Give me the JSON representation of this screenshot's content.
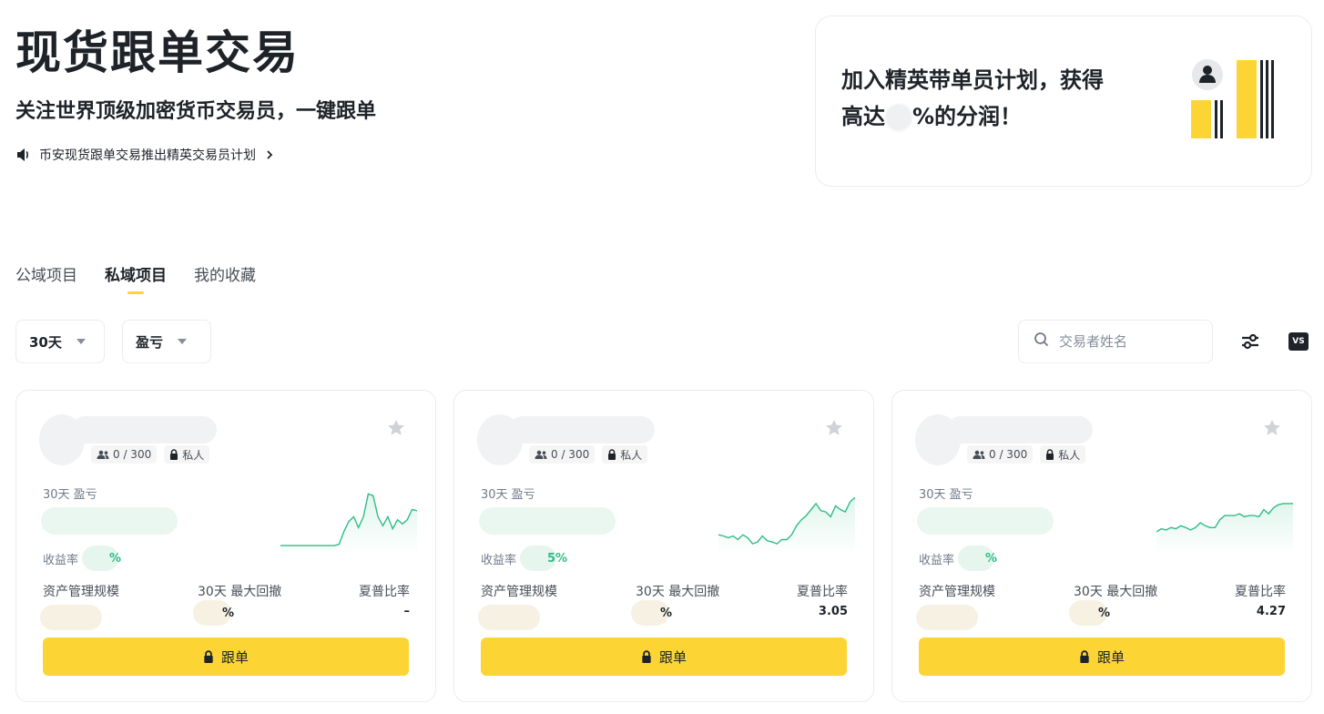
{
  "hero": {
    "title": "现货跟单交易",
    "subtitle": "关注世界顶级加密货币交易员，一键跟单",
    "announcement": "币安现货跟单交易推出精英交易员计划"
  },
  "promo": {
    "line1": "加入精英带单员计划，获得",
    "line2_prefix": "高达",
    "line2_suffix": "%的分润！"
  },
  "tabs": [
    {
      "label": "公域项目",
      "active": false
    },
    {
      "label": "私域项目",
      "active": true
    },
    {
      "label": "我的收藏",
      "active": false
    }
  ],
  "filters": {
    "period": "30天",
    "sort": "盈亏",
    "search_placeholder": "交易者姓名",
    "vs_label": "VS"
  },
  "cards": [
    {
      "followers": "0 / 300",
      "privacy": "私人",
      "pnl_label": "30天 盈亏",
      "roi_label": "收益率",
      "roi_suffix": "%",
      "aum_label": "资产管理规模",
      "mdd_label": "30天 最大回撤",
      "mdd_suffix": "%",
      "sharpe_label": "夏普比率",
      "sharpe_value": "–",
      "follow_label": "跟单",
      "sparkline": [
        0.12,
        0.12,
        0.12,
        0.12,
        0.12,
        0.12,
        0.12,
        0.12,
        0.12,
        0.12,
        0.12,
        0.12,
        0.14,
        0.35,
        0.52,
        0.6,
        0.42,
        0.6,
        0.98,
        0.95,
        0.6,
        0.45,
        0.6,
        0.4,
        0.55,
        0.48,
        0.55,
        0.72,
        0.7
      ]
    },
    {
      "followers": "0 / 300",
      "privacy": "私人",
      "pnl_label": "30天 盈亏",
      "roi_label": "收益率",
      "roi_suffix": "5%",
      "aum_label": "资产管理规模",
      "mdd_label": "30天 最大回撤",
      "mdd_suffix": "%",
      "sharpe_label": "夏普比率",
      "sharpe_value": "3.05",
      "follow_label": "跟单",
      "sparkline": [
        0.3,
        0.28,
        0.25,
        0.28,
        0.22,
        0.3,
        0.25,
        0.15,
        0.18,
        0.28,
        0.2,
        0.18,
        0.15,
        0.22,
        0.22,
        0.3,
        0.45,
        0.55,
        0.62,
        0.72,
        0.82,
        0.7,
        0.68,
        0.6,
        0.78,
        0.72,
        0.68,
        0.85,
        0.92
      ]
    },
    {
      "followers": "0 / 300",
      "privacy": "私人",
      "pnl_label": "30天 盈亏",
      "roi_label": "收益率",
      "roi_suffix": "%",
      "aum_label": "资产管理规模",
      "mdd_label": "30天 最大回撤",
      "mdd_suffix": "%",
      "sharpe_label": "夏普比率",
      "sharpe_value": "4.27",
      "follow_label": "跟单",
      "sparkline": [
        0.35,
        0.4,
        0.38,
        0.42,
        0.4,
        0.45,
        0.42,
        0.38,
        0.42,
        0.5,
        0.45,
        0.42,
        0.42,
        0.55,
        0.62,
        0.62,
        0.62,
        0.65,
        0.6,
        0.62,
        0.62,
        0.6,
        0.72,
        0.65,
        0.75,
        0.8,
        0.82,
        0.82,
        0.82
      ]
    }
  ],
  "colors": {
    "accent": "#fcd535",
    "positive": "#2ebd85",
    "text_primary": "#1e2329",
    "text_secondary": "#707a8a"
  }
}
